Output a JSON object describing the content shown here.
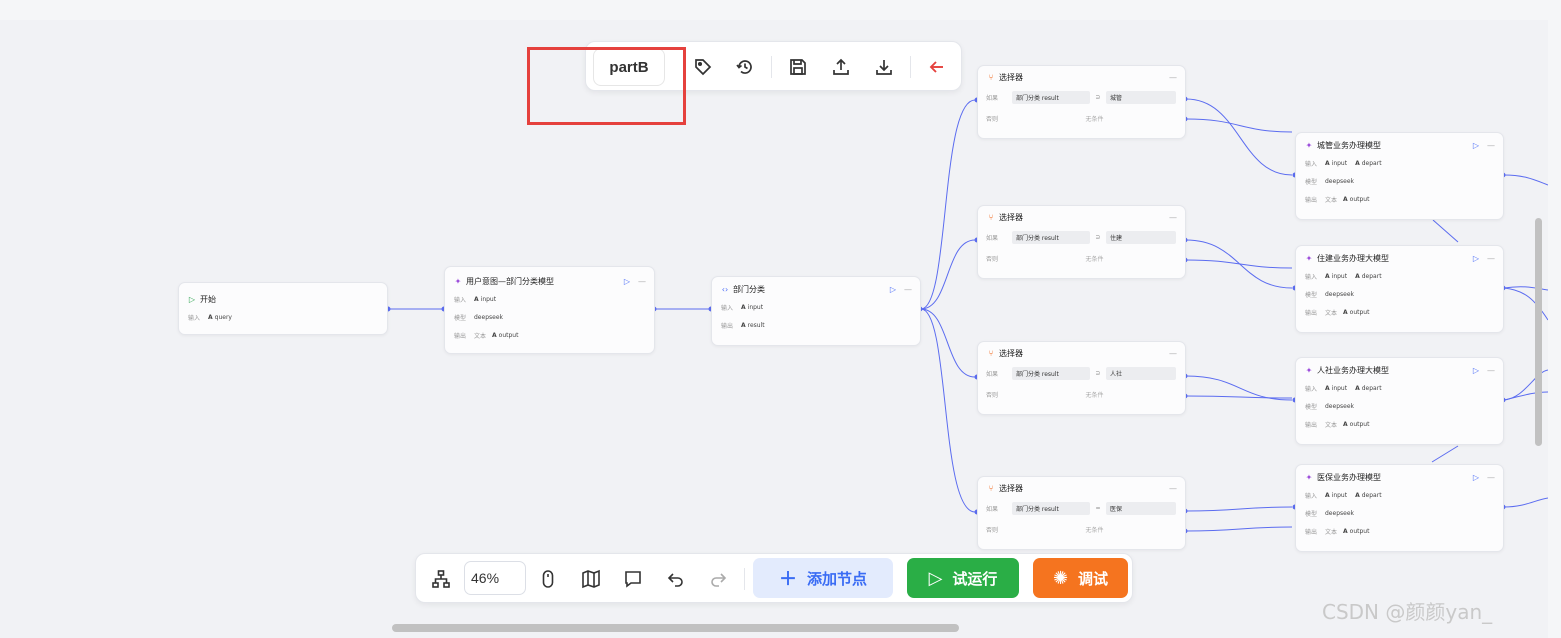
{
  "toolbar_top": {
    "flow_name": "partB"
  },
  "toolbar_bottom": {
    "zoom": "46%",
    "add_node_label": "添加节点",
    "trial_run_label": "试运行",
    "debug_label": "调试"
  },
  "labels": {
    "input": "输入",
    "model": "模型",
    "output": "输出",
    "text": "文本",
    "if": "如果",
    "else": "否则",
    "no_condition": "无条件"
  },
  "nodes": {
    "start": {
      "title": "开始",
      "input_var": "query"
    },
    "intent": {
      "title": "用户意图—部门分类模型",
      "input_var": "input",
      "model": "deepseek",
      "output_var": "output"
    },
    "dept": {
      "title": "部门分类",
      "input_var": "input",
      "output_var": "result"
    },
    "sel1": {
      "title": "选择器",
      "var": "部门分类 result",
      "value": "城管"
    },
    "sel2": {
      "title": "选择器",
      "var": "部门分类 result",
      "value": "住建"
    },
    "sel3": {
      "title": "选择器",
      "var": "部门分类 result",
      "value": "人社"
    },
    "sel4": {
      "title": "选择器",
      "var": "部门分类 result",
      "value": "医保"
    },
    "m1": {
      "title": "城管业务办理模型",
      "input_var": "input",
      "input_var2": "depart",
      "model": "deepseek",
      "output_var": "output"
    },
    "m2": {
      "title": "住建业务办理大模型",
      "input_var": "input",
      "input_var2": "depart",
      "model": "deepseek",
      "output_var": "output"
    },
    "m3": {
      "title": "人社业务办理大模型",
      "input_var": "input",
      "input_var2": "depart",
      "model": "deepseek",
      "output_var": "output"
    },
    "m4": {
      "title": "医保业务办理模型",
      "input_var": "input",
      "input_var2": "depart",
      "model": "deepseek",
      "output_var": "output"
    }
  },
  "watermark": "CSDN @颜颜yan_"
}
